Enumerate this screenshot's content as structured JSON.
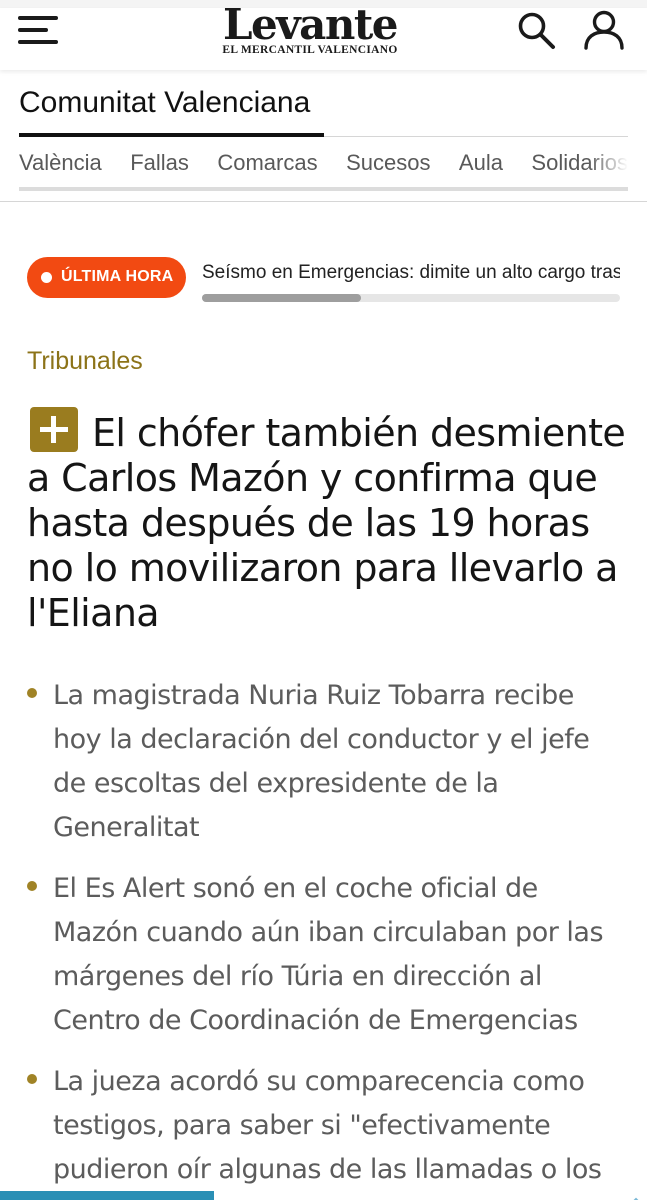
{
  "header": {
    "logo_main": "Levante",
    "logo_sub": "EL MERCANTIL VALENCIANO",
    "menu_icon": "hamburger-menu-icon",
    "search_icon": "search-icon",
    "user_icon": "user-icon"
  },
  "section": {
    "title": "Comunitat Valenciana",
    "subnav": [
      "València",
      "Fallas",
      "Comarcas",
      "Sucesos",
      "Aula",
      "Solidarios"
    ]
  },
  "breaking": {
    "label": "ÚLTIMA HORA",
    "headline": "Seísmo en Emergencias: dimite un alto cargo tras la dana",
    "progress": 0.38
  },
  "article": {
    "kicker": "Tribunales",
    "premium_icon": "plus-icon",
    "headline": "El chófer también desmiente a Carlos Mazón y confirma que hasta después de las 19 horas no lo movilizaron para llevarlo a l'Eliana",
    "bullets": [
      "La magistrada Nuria Ruiz Tobarra recibe hoy la declaración del conductor y el jefe de escoltas del expresidente de la Generalitat",
      "El Es Alert sonó en el coche oficial de Mazón cuando aún iban circulaban por las márgenes del río Túria en dirección al Centro de Coordinación de Emergencias",
      "La jueza acordó su comparecencia como testigos, para saber si \"efectivamente pudieron oír algunas de las llamadas o los"
    ]
  },
  "colors": {
    "accent_gold": "#9a7c1f",
    "breaking_orange": "#f24a12",
    "text_dark": "#151515",
    "text_gray": "#5c5c5c"
  }
}
